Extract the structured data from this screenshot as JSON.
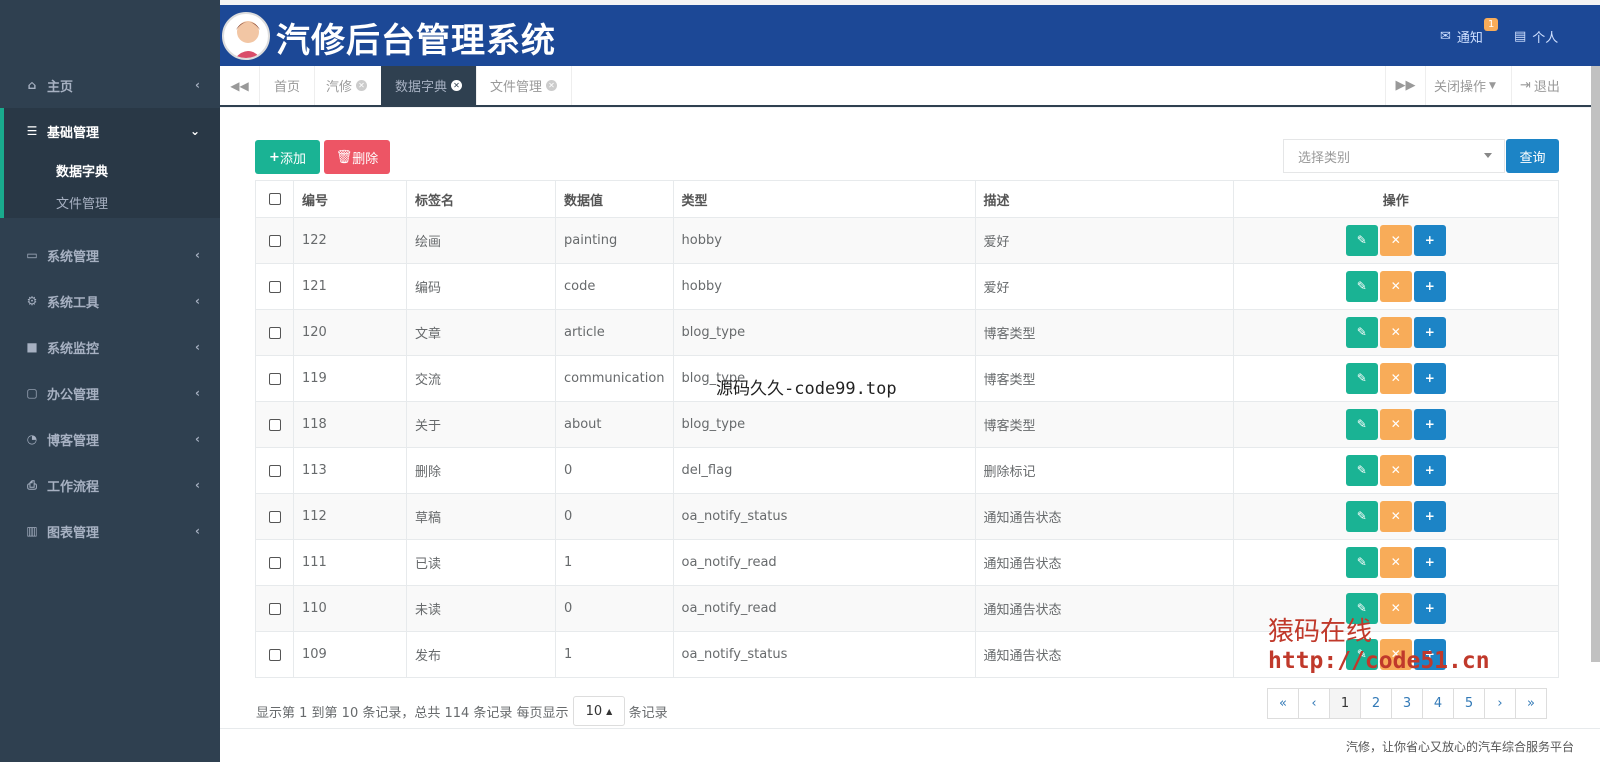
{
  "app": {
    "title": "汽修后台管理系统"
  },
  "header": {
    "notify_label": "通知",
    "notify_count": "1",
    "profile_label": "个人"
  },
  "sidebar": {
    "home": "主页",
    "group": "基础管理",
    "sub_items": [
      "数据字典",
      "文件管理"
    ],
    "items": [
      "系统管理",
      "系统工具",
      "系统监控",
      "办公管理",
      "博客管理",
      "工作流程",
      "图表管理"
    ]
  },
  "tabs": {
    "items": [
      "首页",
      "汽修",
      "数据字典",
      "文件管理"
    ],
    "active": "数据字典",
    "close_ops": "关闭操作",
    "logout": "退出"
  },
  "toolbar": {
    "add_label": "添加",
    "delete_label": "删除",
    "category_placeholder": "选择类别",
    "query_label": "查询"
  },
  "table": {
    "headers": [
      "编号",
      "标签名",
      "数据值",
      "类型",
      "描述",
      "操作"
    ],
    "rows": [
      [
        "122",
        "绘画",
        "painting",
        "hobby",
        "爱好"
      ],
      [
        "121",
        "编码",
        "code",
        "hobby",
        "爱好"
      ],
      [
        "120",
        "文章",
        "article",
        "blog_type",
        "博客类型"
      ],
      [
        "119",
        "交流",
        "communication",
        "blog_type",
        "博客类型"
      ],
      [
        "118",
        "关于",
        "about",
        "blog_type",
        "博客类型"
      ],
      [
        "113",
        "删除",
        "0",
        "del_flag",
        "删除标记"
      ],
      [
        "112",
        "草稿",
        "0",
        "oa_notify_status",
        "通知通告状态"
      ],
      [
        "111",
        "已读",
        "1",
        "oa_notify_read",
        "通知通告状态"
      ],
      [
        "110",
        "未读",
        "0",
        "oa_notify_read",
        "通知通告状态"
      ],
      [
        "109",
        "发布",
        "1",
        "oa_notify_status",
        "通知通告状态"
      ]
    ]
  },
  "pagination": {
    "info": "显示第 1 到第 10 条记录，总共 114 条记录 每页显示",
    "page_size": "10",
    "suffix": "条记录",
    "pages": [
      "«",
      "‹",
      "1",
      "2",
      "3",
      "4",
      "5",
      "›",
      "»"
    ],
    "current": "1"
  },
  "footer": {
    "text": "汽修，让你省心又放心的汽车综合服务平台"
  },
  "watermarks": [
    "源码久久-code99.top",
    "猿码在线",
    "http://code51.cn"
  ],
  "colors": {
    "sidebar": "#2f4050",
    "header": "#1c4896",
    "primary": "#1ab394",
    "danger": "#ed5565",
    "warning": "#f8ac59",
    "info": "#1c84c6"
  }
}
